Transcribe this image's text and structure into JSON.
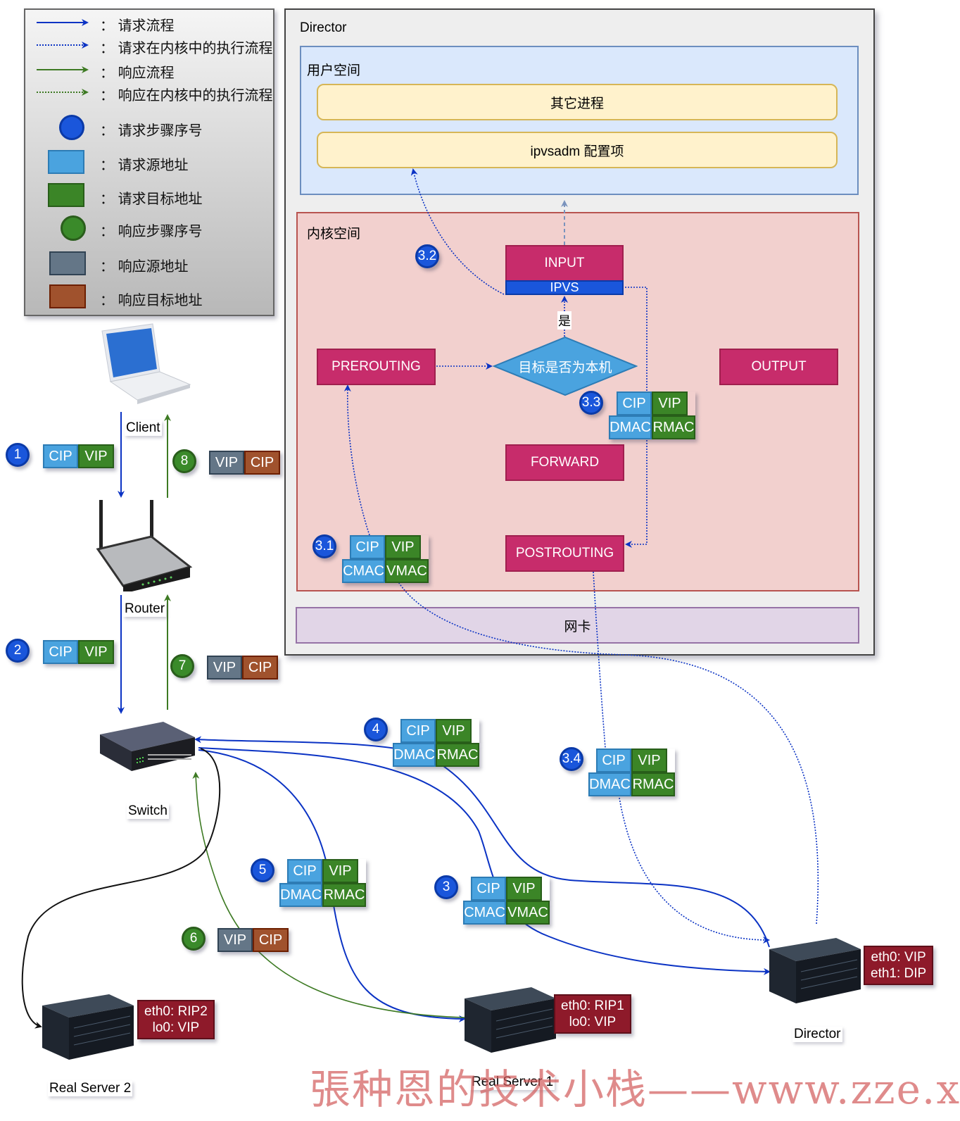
{
  "legend": {
    "items": [
      {
        "kind": "line-solid-blue",
        "label": "请求流程"
      },
      {
        "kind": "line-dotted-blue",
        "label": "请求在内核中的执行流程"
      },
      {
        "kind": "line-solid-green",
        "label": "响应流程"
      },
      {
        "kind": "line-dotted-green",
        "label": "响应在内核中的执行流程"
      },
      {
        "kind": "circle-blue",
        "label": "请求步骤序号"
      },
      {
        "kind": "rect-light-blue",
        "label": "请求源地址"
      },
      {
        "kind": "rect-green",
        "label": "请求目标地址"
      },
      {
        "kind": "circle-green",
        "label": "响应步骤序号"
      },
      {
        "kind": "rect-slate",
        "label": "响应源地址"
      },
      {
        "kind": "rect-brown",
        "label": "响应目标地址"
      }
    ],
    "separator": "："
  },
  "director": {
    "title": "Director",
    "user_space": {
      "title": "用户空间",
      "other_processes": "其它进程",
      "ipvsadm": "ipvsadm 配置项"
    },
    "kernel_space": {
      "title": "内核空间",
      "input": "INPUT",
      "ipvs": "IPVS",
      "prerouting": "PREROUTING",
      "decision": "目标是否为本机",
      "yes": "是",
      "output": "OUTPUT",
      "forward": "FORWARD",
      "postrouting": "POSTROUTING"
    },
    "nic": "网卡"
  },
  "devices": {
    "client": "Client",
    "router": "Router",
    "switch": "Switch",
    "real_server_1": {
      "label": "Real Server 1",
      "iface": [
        "eth0: RIP1",
        "lo0: VIP"
      ]
    },
    "real_server_2": {
      "label": "Real Server 2",
      "iface": [
        "eth0: RIP2",
        "lo0: VIP"
      ]
    },
    "director_server": {
      "label": "Director",
      "iface": [
        "eth0: VIP",
        "eth1: DIP"
      ]
    }
  },
  "steps": {
    "s1": {
      "num": "1",
      "src": "CIP",
      "dst": "VIP"
    },
    "s2": {
      "num": "2",
      "src": "CIP",
      "dst": "VIP"
    },
    "s3": {
      "num": "3",
      "src": "CIP",
      "dst": "VIP",
      "smac": "CMAC",
      "dmac": "VMAC"
    },
    "s3_1": {
      "num": "3.1",
      "src": "CIP",
      "dst": "VIP",
      "smac": "CMAC",
      "dmac": "VMAC"
    },
    "s3_2": {
      "num": "3.2"
    },
    "s3_3": {
      "num": "3.3",
      "src": "CIP",
      "dst": "VIP",
      "smac": "DMAC",
      "dmac": "RMAC"
    },
    "s3_4": {
      "num": "3.4",
      "src": "CIP",
      "dst": "VIP",
      "smac": "DMAC",
      "dmac": "RMAC"
    },
    "s4": {
      "num": "4",
      "src": "CIP",
      "dst": "VIP",
      "smac": "DMAC",
      "dmac": "RMAC"
    },
    "s5": {
      "num": "5",
      "src": "CIP",
      "dst": "VIP",
      "smac": "DMAC",
      "dmac": "RMAC"
    },
    "s6": {
      "num": "6",
      "src": "VIP",
      "dst": "CIP"
    },
    "s7": {
      "num": "7",
      "src": "VIP",
      "dst": "CIP"
    },
    "s8": {
      "num": "8",
      "src": "VIP",
      "dst": "CIP"
    }
  },
  "colors": {
    "request": "#0b33c4",
    "response": "#3d7a23",
    "hook": "#c72c6b",
    "ipvs": "#1a56db",
    "src_addr": "#4aa3df",
    "dst_addr": "#3b8527",
    "resp_src": "#647687",
    "resp_dst": "#a0522d"
  },
  "watermark": "張种恩的技术小栈——www.zze.xyz"
}
